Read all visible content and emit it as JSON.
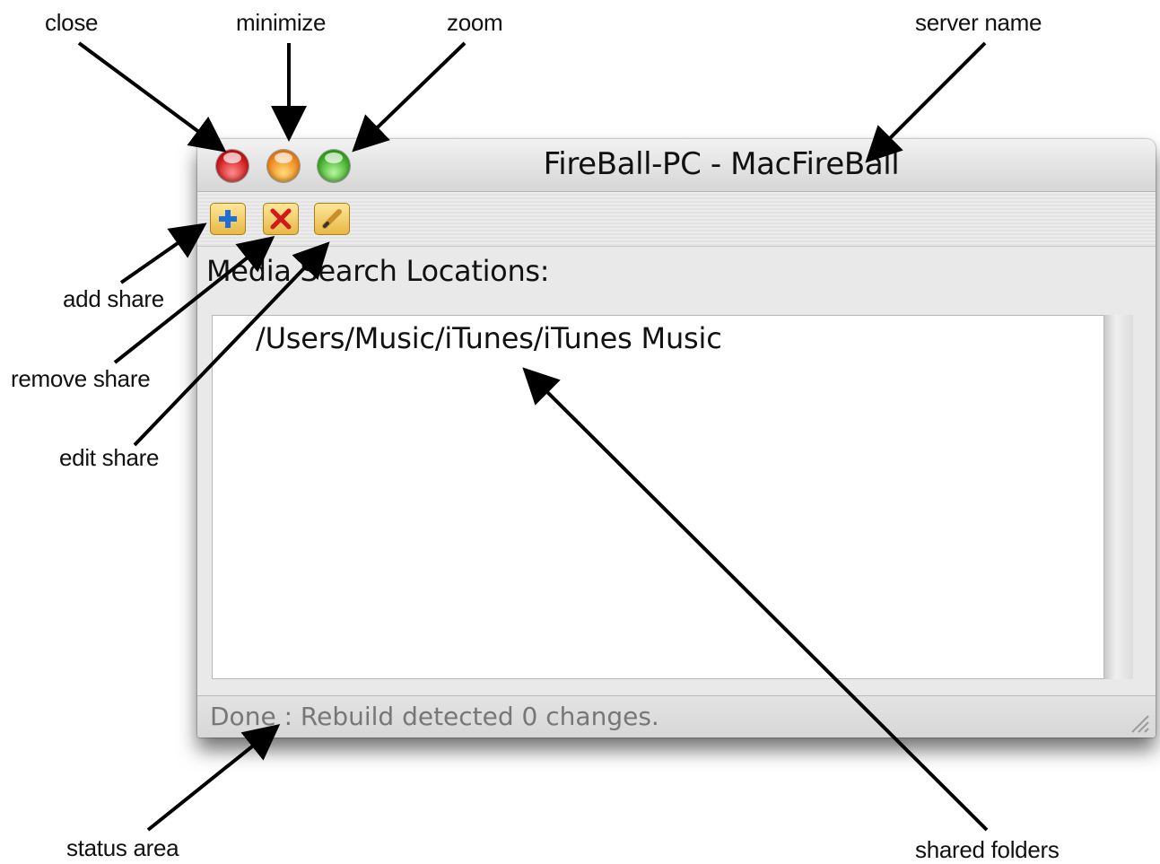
{
  "window": {
    "title": "FireBall-PC - MacFireBall",
    "section_label": "Media Search Locations:",
    "shares": [
      "/Users/Music/iTunes/iTunes Music"
    ],
    "status": "Done : Rebuild detected 0 changes."
  },
  "toolbar": {
    "add_icon": "folder-add-icon",
    "remove_icon": "folder-remove-icon",
    "edit_icon": "folder-edit-icon"
  },
  "callouts": {
    "close": "close",
    "minimize": "minimize",
    "zoom": "zoom",
    "server_name": "server name",
    "add_share": "add share",
    "remove_share": "remove share",
    "edit_share": "edit share",
    "status_area": "status area",
    "shared_folders": "shared folders"
  },
  "colors": {
    "close": "#d0191c",
    "minimize": "#f0861a",
    "zoom": "#3fae25"
  }
}
